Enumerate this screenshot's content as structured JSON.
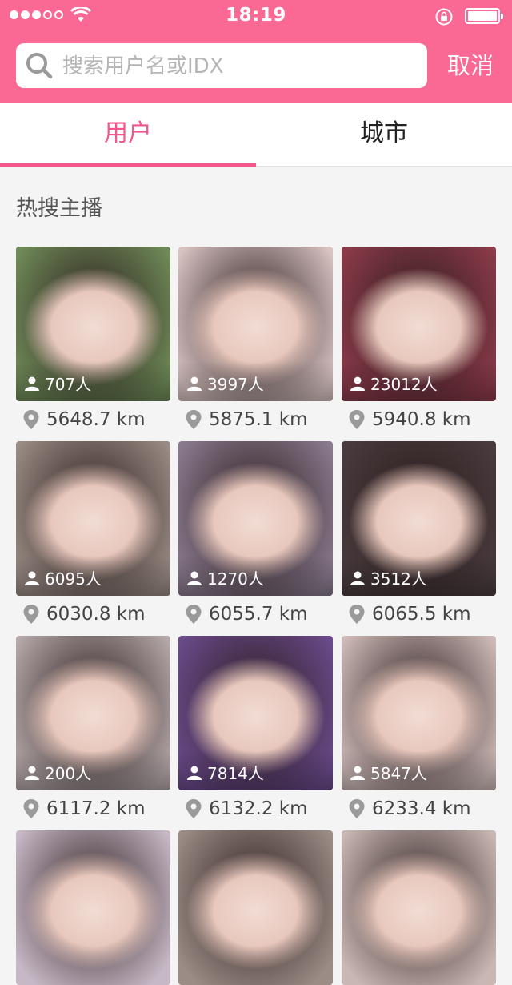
{
  "status": {
    "time": "18:19",
    "signal_filled": 3,
    "signal_total": 5
  },
  "search": {
    "placeholder": "搜索用户名或IDX",
    "value": "",
    "cancel_label": "取消"
  },
  "tabs": [
    {
      "label": "用户",
      "active": true
    },
    {
      "label": "城市",
      "active": false
    }
  ],
  "section_title": "热搜主播",
  "icons": {
    "search": "search-icon",
    "viewer": "person-icon",
    "location": "location-pin-icon",
    "wifi": "wifi-icon",
    "lock": "rotation-lock-icon",
    "battery": "battery-icon"
  },
  "colors": {
    "accent": "#fa6894",
    "tab_active": "#f2568a"
  },
  "streamers": [
    {
      "viewers": "707人",
      "distance": "5648.7 km",
      "bg": "#6f8a58"
    },
    {
      "viewers": "3997人",
      "distance": "5875.1 km",
      "bg": "#d8c2c2"
    },
    {
      "viewers": "23012人",
      "distance": "5940.8 km",
      "bg": "#8c3a4a"
    },
    {
      "viewers": "6095人",
      "distance": "6030.8 km",
      "bg": "#9a8b84"
    },
    {
      "viewers": "1270人",
      "distance": "6055.7 km",
      "bg": "#8a7a8e"
    },
    {
      "viewers": "3512人",
      "distance": "6065.5 km",
      "bg": "#4a3c3e"
    },
    {
      "viewers": "200人",
      "distance": "6117.2 km",
      "bg": "#b4a7a8"
    },
    {
      "viewers": "7814人",
      "distance": "6132.2 km",
      "bg": "#6a4a8a"
    },
    {
      "viewers": "5847人",
      "distance": "6233.4 km",
      "bg": "#cdbab8"
    },
    {
      "viewers": "",
      "distance": "",
      "bg": "#c7b8c6"
    },
    {
      "viewers": "",
      "distance": "",
      "bg": "#9c8c86"
    },
    {
      "viewers": "",
      "distance": "",
      "bg": "#c9b7b3"
    }
  ]
}
